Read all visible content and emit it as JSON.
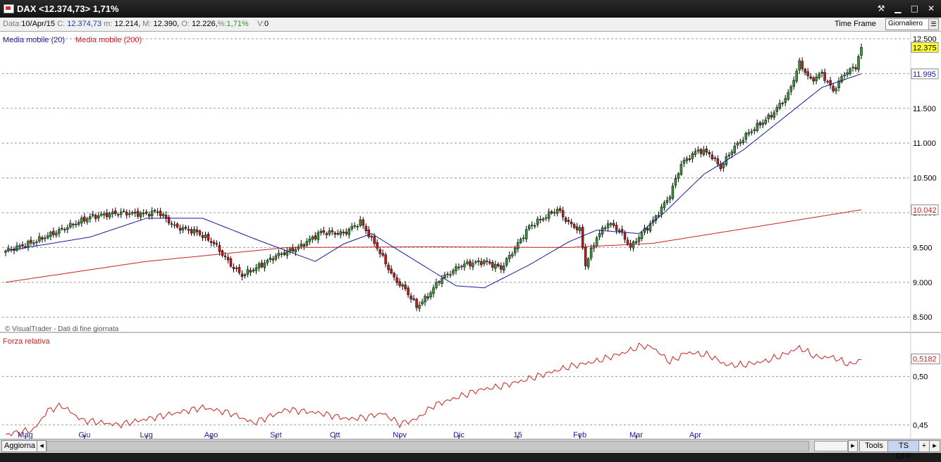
{
  "window": {
    "title": "DAX <12.374,73> 1,71%"
  },
  "window_controls": {
    "tools_glyph": "⚒",
    "minimize_glyph": "▁",
    "maximize_glyph": "□",
    "close_glyph": "✕"
  },
  "info": {
    "date_k": "Data:",
    "date_v": "10/Apr/15",
    "close_k": "C:",
    "close_v": "12.374,73",
    "min_k": "m:",
    "min_v": "12.214",
    "max_k": "M:",
    "max_v": "12.390",
    "open_k": "O:",
    "open_v": "12.226,",
    "pct_k": "%:",
    "pct_v": "1,71%",
    "vol_k": "V:",
    "vol_v": "0"
  },
  "timeframe": {
    "label": "Time Frame",
    "selected": "Giornaliero"
  },
  "statusbar": {
    "refresh": "Aggiorna",
    "tools": "Tools",
    "ts_off": "TS OFF",
    "plus": "+",
    "more": "▸",
    "scroll_left": "◂",
    "scroll_right": "▸"
  },
  "colors": {
    "up": "#2f9a2f",
    "down": "#c41a1a",
    "ma20": "#1a1a9a",
    "ma200": "#cc2222",
    "rs": "#cc2222",
    "grid": "#9a9a9a"
  },
  "chart_data": [
    {
      "type": "candlestick",
      "legend": [
        {
          "name": "Media mobile (20)",
          "color": "#1a1a9a"
        },
        {
          "name": "Media mobile (200)",
          "color": "#cc2222"
        }
      ],
      "watermark": "© VisualTrader - Dati di fine giornata",
      "ylim": [
        8300,
        12550
      ],
      "y_ticks": [
        8500,
        9000,
        9500,
        10000,
        10500,
        11000,
        11500,
        12000,
        12500
      ],
      "y_tick_labels": [
        "8.500",
        "9.000",
        "9.500",
        "10.000",
        "10.500",
        "11.000",
        "11.500",
        "12.000",
        "12.500"
      ],
      "x_labels": [
        "Mag",
        "Giu",
        "Lug",
        "Ago",
        "Set",
        "Ott",
        "Nov",
        "Dic",
        "15",
        "Feb",
        "Mar",
        "Apr"
      ],
      "price_badges": [
        {
          "value": 12375,
          "label": "12.375",
          "bg": "#ffff33",
          "fg": "#000000",
          "border": "#888888"
        },
        {
          "value": 11995,
          "label": "11.995",
          "bg": "#ffffff",
          "fg": "#1a1a9a",
          "border": "#888888"
        },
        {
          "value": 10042,
          "label": "10.042",
          "bg": "#ffffff",
          "fg": "#cc2222",
          "border": "#888888"
        }
      ],
      "close_anchors": [
        [
          0,
          9450
        ],
        [
          10,
          9580
        ],
        [
          20,
          9760
        ],
        [
          30,
          9940
        ],
        [
          40,
          10000
        ],
        [
          50,
          9980
        ],
        [
          54,
          10020
        ],
        [
          60,
          9800
        ],
        [
          68,
          9720
        ],
        [
          74,
          9560
        ],
        [
          80,
          9250
        ],
        [
          84,
          9100
        ],
        [
          90,
          9230
        ],
        [
          96,
          9380
        ],
        [
          104,
          9500
        ],
        [
          112,
          9720
        ],
        [
          120,
          9700
        ],
        [
          126,
          9870
        ],
        [
          132,
          9500
        ],
        [
          138,
          9050
        ],
        [
          142,
          8900
        ],
        [
          146,
          8650
        ],
        [
          150,
          8800
        ],
        [
          154,
          9030
        ],
        [
          162,
          9250
        ],
        [
          170,
          9300
        ],
        [
          176,
          9200
        ],
        [
          182,
          9550
        ],
        [
          186,
          9800
        ],
        [
          192,
          9950
        ],
        [
          196,
          10050
        ],
        [
          200,
          9850
        ],
        [
          204,
          9750
        ],
        [
          206,
          9250
        ],
        [
          210,
          9650
        ],
        [
          214,
          9850
        ],
        [
          218,
          9750
        ],
        [
          222,
          9500
        ],
        [
          226,
          9700
        ],
        [
          230,
          9880
        ],
        [
          236,
          10250
        ],
        [
          240,
          10700
        ],
        [
          246,
          10900
        ],
        [
          250,
          10850
        ],
        [
          254,
          10650
        ],
        [
          258,
          10900
        ],
        [
          264,
          11150
        ],
        [
          272,
          11400
        ],
        [
          278,
          11700
        ],
        [
          282,
          12150
        ],
        [
          286,
          11900
        ],
        [
          290,
          12000
        ],
        [
          294,
          11750
        ],
        [
          298,
          12000
        ],
        [
          302,
          12100
        ],
        [
          304,
          12375
        ]
      ],
      "ma20_anchors": [
        [
          0,
          9450
        ],
        [
          30,
          9650
        ],
        [
          50,
          9920
        ],
        [
          70,
          9920
        ],
        [
          90,
          9600
        ],
        [
          110,
          9300
        ],
        [
          120,
          9550
        ],
        [
          130,
          9700
        ],
        [
          150,
          9200
        ],
        [
          160,
          8950
        ],
        [
          170,
          8920
        ],
        [
          186,
          9250
        ],
        [
          200,
          9580
        ],
        [
          210,
          9750
        ],
        [
          225,
          9700
        ],
        [
          234,
          10000
        ],
        [
          248,
          10550
        ],
        [
          262,
          10900
        ],
        [
          276,
          11350
        ],
        [
          290,
          11800
        ],
        [
          304,
          11995
        ]
      ],
      "ma200_anchors": [
        [
          0,
          9000
        ],
        [
          50,
          9300
        ],
        [
          100,
          9500
        ],
        [
          150,
          9510
        ],
        [
          200,
          9500
        ],
        [
          230,
          9560
        ],
        [
          270,
          9820
        ],
        [
          304,
          10042
        ]
      ]
    },
    {
      "type": "line",
      "legend": [
        {
          "name": "Forza relativa",
          "color": "#cc2222"
        }
      ],
      "ylim": [
        0.44,
        0.542
      ],
      "y_ticks": [
        0.45,
        0.5
      ],
      "y_tick_labels": [
        "0,45",
        "0,50"
      ],
      "last_badge": {
        "value": 0.5182,
        "label": "0,5182"
      },
      "anchors": [
        [
          0,
          0.44
        ],
        [
          10,
          0.445
        ],
        [
          15,
          0.465
        ],
        [
          20,
          0.47
        ],
        [
          27,
          0.455
        ],
        [
          40,
          0.45
        ],
        [
          60,
          0.462
        ],
        [
          70,
          0.468
        ],
        [
          80,
          0.462
        ],
        [
          88,
          0.452
        ],
        [
          100,
          0.466
        ],
        [
          112,
          0.462
        ],
        [
          122,
          0.456
        ],
        [
          128,
          0.458
        ],
        [
          134,
          0.462
        ],
        [
          140,
          0.451
        ],
        [
          146,
          0.456
        ],
        [
          152,
          0.47
        ],
        [
          160,
          0.478
        ],
        [
          168,
          0.486
        ],
        [
          176,
          0.49
        ],
        [
          184,
          0.496
        ],
        [
          192,
          0.503
        ],
        [
          200,
          0.51
        ],
        [
          210,
          0.516
        ],
        [
          220,
          0.525
        ],
        [
          226,
          0.532
        ],
        [
          230,
          0.53
        ],
        [
          236,
          0.515
        ],
        [
          242,
          0.525
        ],
        [
          250,
          0.522
        ],
        [
          256,
          0.512
        ],
        [
          262,
          0.512
        ],
        [
          270,
          0.516
        ],
        [
          276,
          0.522
        ],
        [
          282,
          0.53
        ],
        [
          288,
          0.52
        ],
        [
          294,
          0.52
        ],
        [
          300,
          0.512
        ],
        [
          304,
          0.518
        ]
      ]
    }
  ]
}
